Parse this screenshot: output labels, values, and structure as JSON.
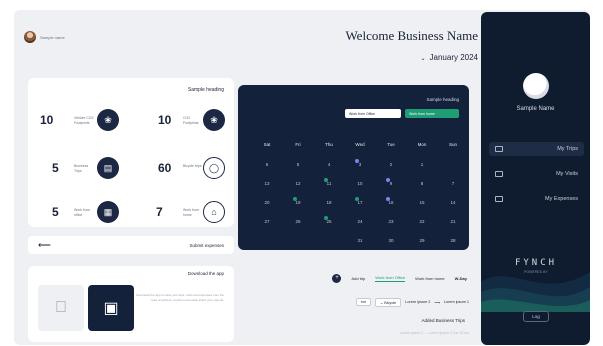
{
  "header": {
    "welcome": "Welcome Business Name",
    "month": "January 2024",
    "user_name": "Sample name"
  },
  "sidebar": {
    "user_name": "Sample Name",
    "items": [
      {
        "label": "My Trips",
        "icon": "briefcase-icon"
      },
      {
        "label": "My Visits",
        "icon": "building-icon"
      },
      {
        "label": "My Expenses",
        "icon": "receipt-icon"
      }
    ],
    "brand": "FYNCH",
    "brand_sub": "POWERED BY",
    "logout_label": "Log"
  },
  "stats": {
    "title": "Sample heading",
    "items": [
      {
        "value": "10",
        "unit": "kg",
        "label": "Vehicle CO2 Footprints",
        "icon": "leaf-icon"
      },
      {
        "value": "10",
        "unit": "per/km",
        "label": "CO2 Footprints",
        "icon": "leaf-icon"
      },
      {
        "value": "5",
        "unit": "",
        "label": "Business Trips",
        "icon": "bus-icon"
      },
      {
        "value": "60",
        "unit": "",
        "label": "Bicycle trips",
        "icon": "bicycle-icon"
      },
      {
        "value": "5",
        "unit": "",
        "label": "Work from office",
        "icon": "office-icon"
      },
      {
        "value": "7",
        "unit": "",
        "label": "Work from home",
        "icon": "home-icon"
      }
    ]
  },
  "submit_expenses": "Submit expenses",
  "download": {
    "title": "Download the app",
    "text": "Download the app to track your trips, visits and expenses from the road, anywhere, anytime and easily share your reports."
  },
  "calendar": {
    "title": "Sample heading",
    "chip_wfh": "Work from home",
    "chip_wfo": "Work from Office",
    "days_of_week": [
      "Sun",
      "Mon",
      "Tue",
      "Wed",
      "Thu",
      "Fri",
      "Sat"
    ],
    "weeks": [
      [
        "",
        "1",
        "2",
        "3",
        "4",
        "5",
        "6"
      ],
      [
        "7",
        "8",
        "9",
        "10",
        "11",
        "12",
        "13"
      ],
      [
        "14",
        "15",
        "16",
        "17",
        "18",
        "19",
        "20"
      ],
      [
        "21",
        "22",
        "23",
        "24",
        "25",
        "26",
        "27"
      ],
      [
        "28",
        "29",
        "30",
        "31",
        "",
        "",
        ""
      ]
    ],
    "accent_green": "#1f9d74",
    "accent_purple": "#8a7cf0"
  },
  "tabs": {
    "items": [
      "W-Day",
      "Work from home",
      "Work from Office",
      "Add trip"
    ],
    "active_index": 2,
    "form_from": "Lorem ipsum 1",
    "form_to": "Lorem ipsum 2",
    "form_select": "Bicycle",
    "form_km": "km",
    "added_label": "Added Business Trips",
    "ghost_text": "Lorem ipsum 1 — Lorem ipsum 2   Car   10   km"
  }
}
